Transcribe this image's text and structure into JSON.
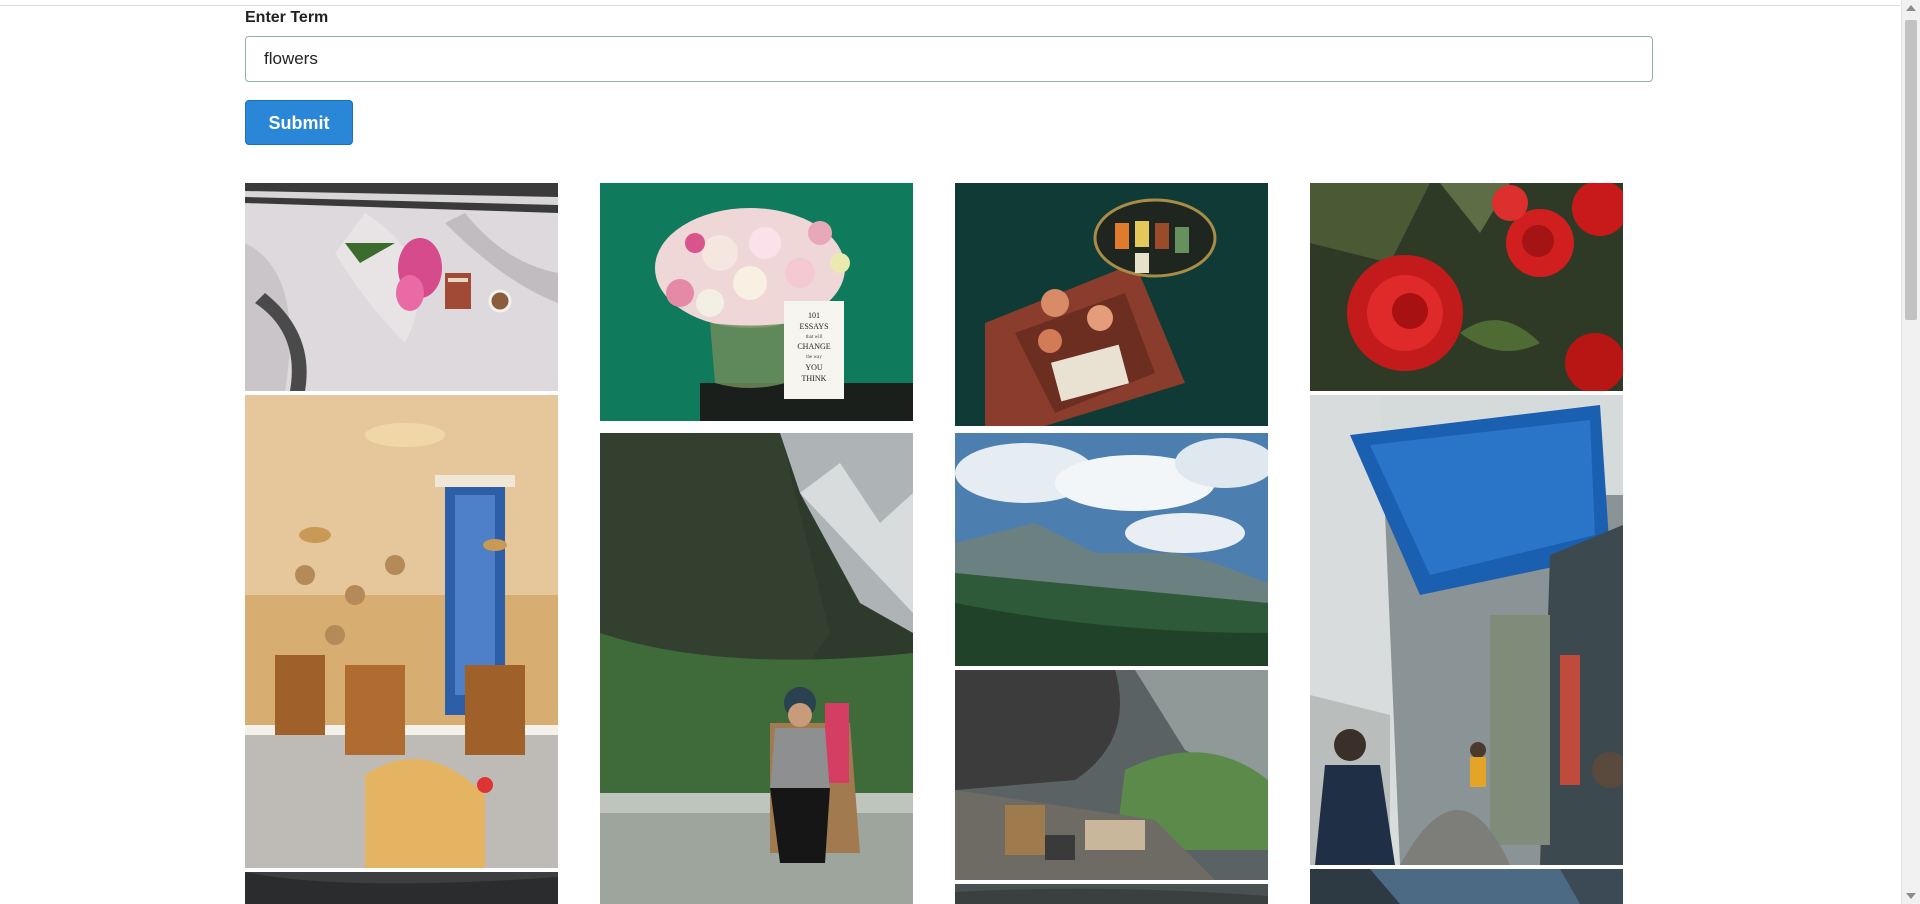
{
  "form": {
    "label": "Enter Term",
    "input_value": "flowers",
    "submit_label": "Submit"
  },
  "gallery": {
    "photos": [
      {
        "id": "bed-flowers",
        "subject": "pink flowers on bed with book and coffee"
      },
      {
        "id": "bouquet-book",
        "subject": "bouquet with 101 Essays book on green background",
        "book_text": [
          "101",
          "ESSAYS",
          "that will",
          "CHANGE",
          "the way",
          "YOU",
          "THINK"
        ]
      },
      {
        "id": "roses-threads",
        "subject": "roses and thread spools on teal background"
      },
      {
        "id": "red-roses",
        "subject": "red roses close-up"
      },
      {
        "id": "cafe-interior",
        "subject": "cafe interior with chairs"
      },
      {
        "id": "mountain-man",
        "subject": "man sitting on mountain ledge"
      },
      {
        "id": "mountain-sky",
        "subject": "mountain valley with clouds"
      },
      {
        "id": "street-tarp",
        "subject": "narrow street with blue tarp"
      },
      {
        "id": "rock-camp",
        "subject": "camp under rock overhang"
      },
      {
        "id": "dark-sky-1",
        "subject": "dark clouds"
      },
      {
        "id": "dark-sky-2",
        "subject": "cloudy sky"
      },
      {
        "id": "cliff-sky",
        "subject": "cliff and sky"
      }
    ]
  }
}
